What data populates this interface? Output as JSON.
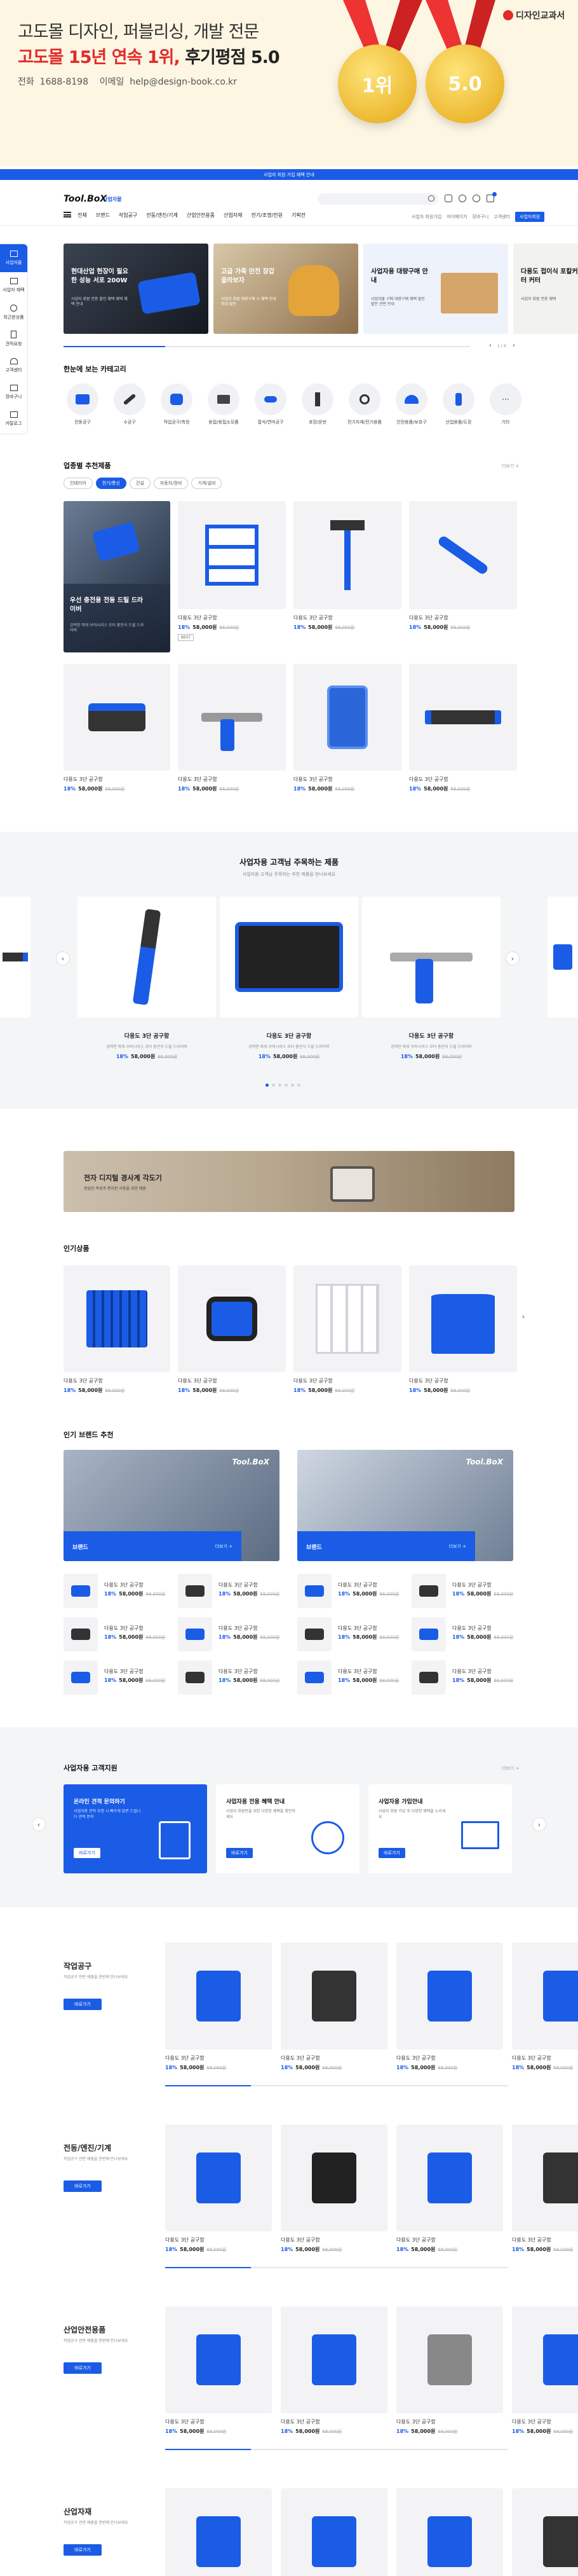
{
  "promo": {
    "line1": "고도몰 디자인, 퍼블리싱, 개발 전문",
    "line2a": "고도몰 15년 연속 1위,",
    "line2b": "후기평점 5.0",
    "contact": "전화  1688-8198    이메일  help@design-book.co.kr",
    "brand": "디자인교과서",
    "medal1": "1위",
    "medal2": "5.0"
  },
  "topbar": {
    "notice": "사업자 회원 가입 혜택 안내"
  },
  "header": {
    "logo": "Tool.BoX",
    "badge": "사업자몰",
    "search_placeholder": "",
    "util": [
      "사업자 회원가입",
      "마이페이지",
      "장바구니",
      "고객센터"
    ],
    "util_btn": "사업자회원"
  },
  "nav": {
    "items": [
      "전체",
      "브랜드",
      "작업공구",
      "전동/엔진/기계",
      "산업안전용품",
      "산업자재",
      "전기/조명/전원",
      "기획전"
    ]
  },
  "sidebar": {
    "items": [
      "사업자몰",
      "사업자 혜택",
      "최근본상품",
      "견적요청",
      "고객센터",
      "장바구니",
      "카탈로그"
    ]
  },
  "hero": {
    "slides": [
      {
        "title": "현대산업 현장이 필요한 성능 서포 200W",
        "desc": "사업자 회원 전용 할인 혜택 혜택 혜택 안내",
        "kind": "dark"
      },
      {
        "title": "고급 가죽 안전 장갑 골라보자",
        "desc": "사업자 회원 대량구매 시 혜택 안내 최대 할인",
        "kind": "dark"
      },
      {
        "title": "사업자용 대량구매 안내",
        "desc": "사업자몰 구매 대량구매 혜택 할인 할인 관련 안내",
        "kind": "light"
      },
      {
        "title": "다용도 접이식 포칼커터 커터",
        "desc": "사업자 회원 전용 혜택",
        "kind": "light"
      }
    ],
    "pager": "1 / 4"
  },
  "categories": {
    "title": "한눈에 보는 카테고리",
    "items": [
      "전동공구",
      "수공구",
      "작업공구/측정",
      "용접/용접소모품",
      "절삭/연마공구",
      "포장/운반",
      "전기자재/전기용품",
      "안전용품/보호구",
      "산업용품/도장",
      "기타"
    ]
  },
  "recommend": {
    "title": "업종별 추천제품",
    "more": "더보기 +",
    "tabs": [
      "인테리어",
      "전기/통신",
      "건설",
      "자동차/정비",
      "기계/설비"
    ],
    "banner_title": "우선 충전용 전동 드릴 드라이버",
    "banner_desc": "강력한 파워 브러시리스 모터 충전식 드릴 드라이버",
    "products": [
      {
        "name": "다용도 3단 공구함",
        "dc": "18%",
        "price": "58,000원",
        "old": "68,000원",
        "tag": "BEST"
      },
      {
        "name": "다용도 3단 공구함",
        "dc": "18%",
        "price": "58,000원",
        "old": "68,000원",
        "tag": ""
      },
      {
        "name": "다용도 3단 공구함",
        "dc": "18%",
        "price": "58,000원",
        "old": "68,000원",
        "tag": ""
      },
      {
        "name": "다용도 3단 공구함",
        "dc": "18%",
        "price": "58,000원",
        "old": "68,000원",
        "tag": ""
      },
      {
        "name": "다용도 3단 공구함",
        "dc": "18%",
        "price": "58,000원",
        "old": "68,000원",
        "tag": ""
      },
      {
        "name": "다용도 3단 공구함",
        "dc": "18%",
        "price": "58,000원",
        "old": "68,000원",
        "tag": ""
      },
      {
        "name": "다용도 3단 공구함",
        "dc": "18%",
        "price": "58,000원",
        "old": "68,000원",
        "tag": ""
      },
      {
        "name": "다용도 3단 공구함",
        "dc": "18%",
        "price": "58,000원",
        "old": "68,000원",
        "tag": ""
      }
    ]
  },
  "featured": {
    "title": "사업자용 고객님 주목하는 제품",
    "subtitle": "사업자용 고객님 주목하는 추천 제품을 만나보세요",
    "items": [
      {
        "name": "다용도 3단 공구함",
        "desc": "강력한 파워 브러시리스 모터 충전식 드릴 드라이버",
        "dc": "18%",
        "price": "58,000원",
        "old": "68,000원"
      },
      {
        "name": "다용도 3단 공구함",
        "desc": "강력한 파워 브러시리스 모터 충전식 드릴 드라이버",
        "dc": "18%",
        "price": "58,000원",
        "old": "68,000원"
      },
      {
        "name": "다용도 3단 공구함",
        "desc": "강력한 파워 브러시리스 모터 충전식 드릴 드라이버",
        "dc": "18%",
        "price": "58,000원",
        "old": "68,000원"
      }
    ]
  },
  "wide_banner": {
    "title": "전자 디지털 경사계 각도기",
    "desc": "정밀한 측정과 편리한 사용을 위한 제품"
  },
  "popular": {
    "title": "인기상품",
    "items": [
      {
        "name": "다용도 3단 공구함",
        "dc": "18%",
        "price": "58,000원",
        "old": "68,000원"
      },
      {
        "name": "다용도 3단 공구함",
        "dc": "18%",
        "price": "58,000원",
        "old": "68,000원"
      },
      {
        "name": "다용도 3단 공구함",
        "dc": "18%",
        "price": "58,000원",
        "old": "68,000원"
      },
      {
        "name": "다용도 3단 공구함",
        "dc": "18%",
        "price": "58,000원",
        "old": "68,000원"
      }
    ]
  },
  "brands": {
    "title": "인기 브랜드 추천",
    "cards": [
      {
        "label": "브랜드",
        "more": "더보기 +",
        "logo": "Tool.BoX"
      },
      {
        "label": "브랜드",
        "more": "더보기 +",
        "logo": "Tool.BoX"
      }
    ],
    "item": {
      "name": "다용도 3단 공구함",
      "dc": "18%",
      "price": "58,000원",
      "old": "68,000원"
    }
  },
  "support": {
    "title": "사업자용 고객지원",
    "more": "더보기 +",
    "cards": [
      {
        "title": "온라인 견적 문의하기",
        "desc": "사업자용 견적 요청 시 빠르게 답변 드립니다 견적 문의",
        "btn": "바로가기"
      },
      {
        "title": "사업자용 전용 혜택 안내",
        "desc": "사업자 회원만을 위한 다양한 혜택을 확인하세요",
        "btn": "바로가기"
      },
      {
        "title": "사업자용 가입안내",
        "desc": "사업자 회원 가입 후 다양한 혜택을 누리세요",
        "btn": "바로가기"
      }
    ]
  },
  "cat_sections": [
    {
      "title": "작업공구",
      "desc": "작업공구 관련 제품을 한번에 만나보세요",
      "btn": "바로가기"
    },
    {
      "title": "전동/엔진/기계",
      "desc": "작업공구 관련 제품을 한번에 만나보세요",
      "btn": "바로가기"
    },
    {
      "title": "산업안전용품",
      "desc": "작업공구 관련 제품을 한번에 만나보세요",
      "btn": "바로가기"
    },
    {
      "title": "산업자재",
      "desc": "작업공구 관련 제품을 한번에 만나보세요",
      "btn": "바로가기"
    }
  ],
  "cat_item": {
    "name": "다용도 3단 공구함",
    "dc": "18%",
    "price": "58,000원",
    "old": "68,000원"
  },
  "colors": {
    "accent": "#1a5ce6",
    "promo_bg": "#fdf6e3",
    "red": "#e22b2b"
  }
}
